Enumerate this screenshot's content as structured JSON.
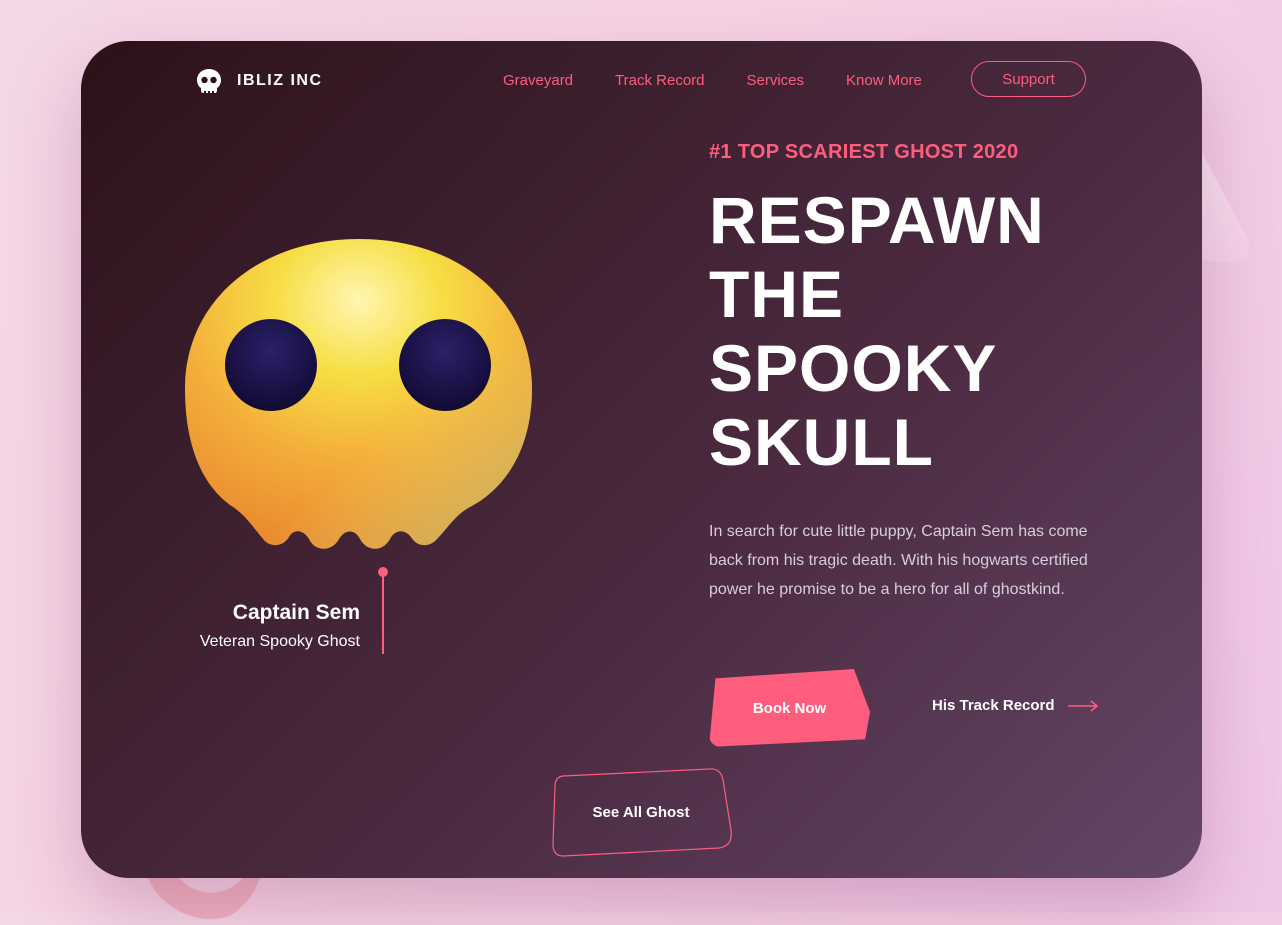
{
  "brand": {
    "name": "IBLIZ INC",
    "logo_icon": "skull-icon"
  },
  "nav": {
    "items": [
      "Graveyard",
      "Track Record",
      "Services",
      "Know More"
    ],
    "support_label": "Support"
  },
  "character": {
    "name": "Captain Sem",
    "role": "Veteran Spooky Ghost"
  },
  "hero": {
    "kicker": "#1 TOP SCARIEST GHOST 2020",
    "headline_lines": [
      "RESPAWN",
      "THE",
      "SPOOKY",
      "SKULL"
    ],
    "description": "In search for cute little puppy, Captain Sem has come back from his tragic death. With his hogwarts certified power he promise to be a hero for all of ghostkind.",
    "book_label": "Book Now",
    "track_label": "His Track Record",
    "see_all_label": "See All Ghost"
  },
  "colors": {
    "accent": "#ff5d7e",
    "card_dark": "#2d1119",
    "card_light": "#634766",
    "skull_yellow": "#f7d23a",
    "skull_orange": "#f0952f",
    "eye": "#1d1450"
  }
}
